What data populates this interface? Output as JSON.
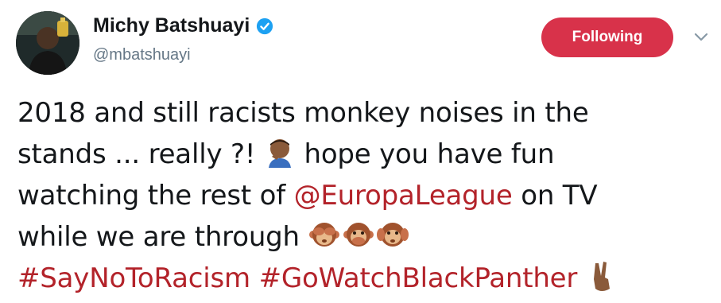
{
  "user": {
    "display_name": "Michy Batshuayi",
    "handle": "@mbatshuayi"
  },
  "follow_button": {
    "label": "Following"
  },
  "tweet": {
    "line1": "2018 and still racists monkey noises in the",
    "line2_a": "stands ... really ?!",
    "line2_b": "hope you have fun",
    "line3_a": "watching the rest of ",
    "line3_mention": "@EuropaLeague",
    "line3_b": " on TV",
    "line4": "while we are through",
    "hashtag1": "#SayNoToRacism",
    "hashtag2": "#GoWatchBlackPanther"
  },
  "emoji": {
    "facepalm": "man-facepalming-emoji",
    "see_no_evil": "see-no-evil-monkey-emoji",
    "speak_no_evil": "speak-no-evil-monkey-emoji",
    "hear_no_evil": "hear-no-evil-monkey-emoji",
    "peace": "victory-hand-emoji"
  },
  "colors": {
    "follow_button_bg": "#d8324a",
    "link": "#b3232a",
    "verified": "#1da1f2",
    "handle": "#657786"
  }
}
